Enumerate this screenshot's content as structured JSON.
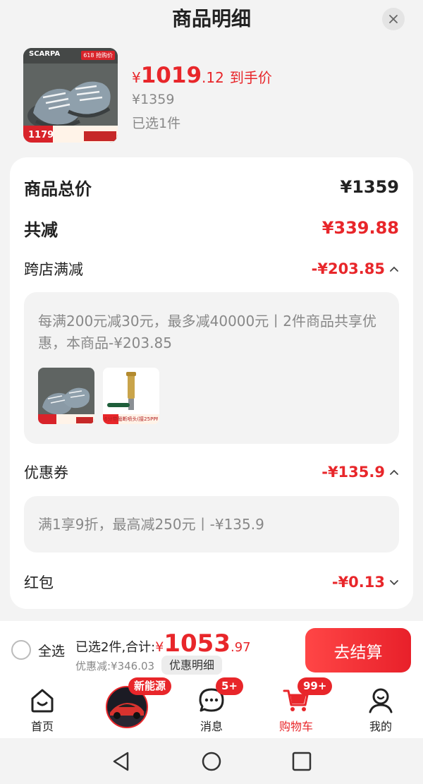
{
  "header": {
    "title": "商品明细"
  },
  "product": {
    "image_brand": "SCARPA",
    "image_promo": "618 抢购价",
    "image_price": "1179",
    "price_currency": "¥",
    "price_int": "1019",
    "price_dec": ".12",
    "price_tag": "到手价",
    "original_price": "¥1359",
    "selected_count": "已选1件"
  },
  "summary": {
    "total_label": "商品总价",
    "total_value": "¥1359",
    "reduce_label": "共减",
    "reduce_value": "¥339.88",
    "cross_store": {
      "label": "跨店满减",
      "value": "-¥203.85",
      "detail": "每满200元减30元，最多减40000元丨2件商品共享优惠，本商品-¥203.85",
      "item2_caption": "6分带截断喷头(接25PPR管)"
    },
    "coupon": {
      "label": "优惠券",
      "value": "-¥135.9",
      "detail": "满1享9折，最高减250元丨-¥135.9"
    },
    "red_packet": {
      "label": "红包",
      "value": "-¥0.13"
    }
  },
  "checkout": {
    "select_all": "全选",
    "sum_label": "已选2件,合计:",
    "sum_currency": "¥",
    "sum_int": "1053",
    "sum_dec": ".97",
    "discount_text": "优惠减:¥346.03",
    "discount_detail_button": "优惠明细",
    "button": "去结算"
  },
  "tabs": [
    {
      "label": "首页"
    },
    {
      "label": "",
      "badge": "新能源"
    },
    {
      "label": "消息",
      "badge": "5+"
    },
    {
      "label": "购物车",
      "badge": "99+"
    },
    {
      "label": "我的"
    }
  ],
  "colors": {
    "accent": "#e8262a",
    "card": "#ffffff",
    "background": "#f3f3f3"
  }
}
